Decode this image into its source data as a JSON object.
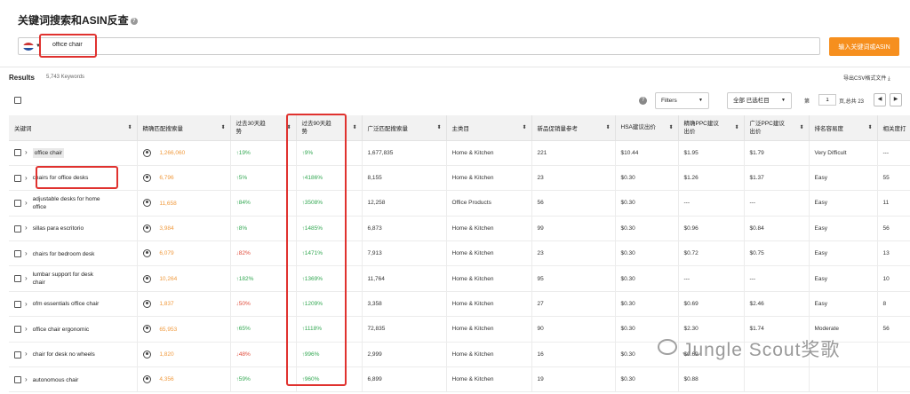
{
  "page": {
    "title": "关键词搜索和ASIN反查",
    "help_icon": "question-icon"
  },
  "search": {
    "value": "office chair",
    "button_label": "输入关键词或ASIN",
    "flag_icon": "us-flag-icon"
  },
  "results": {
    "label": "Results",
    "count": "5,743 Keywords",
    "export_label": "导出CSV格式文件"
  },
  "controls": {
    "filters_label": "Filters",
    "columns_label": "全部 已选栏目",
    "page_prefix": "第",
    "page_number": "1",
    "page_suffix": "页,总共 23"
  },
  "table": {
    "columns": [
      "关键词",
      "精确匹配搜索量",
      "过去30天趋势",
      "过去90天趋势",
      "广泛匹配搜索量",
      "主类目",
      "新品促销量参考",
      "HSA建议出价",
      "精确PPC建议出价",
      "广泛PPC建议出价",
      "排名容易度",
      "相关度打"
    ],
    "rows": [
      {
        "keyword": "office chair",
        "exact": "1,266,060",
        "t30": "19%",
        "t30_dir": "up",
        "t90": "9%",
        "broad": "1,677,835",
        "category": "Home & Kitchen",
        "promo": "221",
        "hsa": "$10.44",
        "exact_ppc": "$1.95",
        "broad_ppc": "$1.79",
        "ease": "Very Difficult",
        "relevance": "---"
      },
      {
        "keyword": "chairs for office desks",
        "exact": "6,796",
        "t30": "5%",
        "t30_dir": "up",
        "t90": "4186%",
        "broad": "8,155",
        "category": "Home & Kitchen",
        "promo": "23",
        "hsa": "$0.30",
        "exact_ppc": "$1.26",
        "broad_ppc": "$1.37",
        "ease": "Easy",
        "relevance": "55"
      },
      {
        "keyword": "adjustable desks for home office",
        "exact": "11,658",
        "t30": "84%",
        "t30_dir": "up",
        "t90": "3508%",
        "broad": "12,258",
        "category": "Office Products",
        "promo": "56",
        "hsa": "$0.30",
        "exact_ppc": "---",
        "broad_ppc": "---",
        "ease": "Easy",
        "relevance": "11"
      },
      {
        "keyword": "sillas para escritorio",
        "exact": "3,984",
        "t30": "8%",
        "t30_dir": "up",
        "t90": "1485%",
        "broad": "6,873",
        "category": "Home & Kitchen",
        "promo": "99",
        "hsa": "$0.30",
        "exact_ppc": "$0.96",
        "broad_ppc": "$0.84",
        "ease": "Easy",
        "relevance": "56"
      },
      {
        "keyword": "chairs for bedroom desk",
        "exact": "6,079",
        "t30": "82%",
        "t30_dir": "down",
        "t90": "1471%",
        "broad": "7,913",
        "category": "Home & Kitchen",
        "promo": "23",
        "hsa": "$0.30",
        "exact_ppc": "$0.72",
        "broad_ppc": "$0.75",
        "ease": "Easy",
        "relevance": "13"
      },
      {
        "keyword": "lumbar support for desk chair",
        "exact": "10,264",
        "t30": "182%",
        "t30_dir": "up",
        "t90": "1369%",
        "broad": "11,764",
        "category": "Home & Kitchen",
        "promo": "95",
        "hsa": "$0.30",
        "exact_ppc": "---",
        "broad_ppc": "---",
        "ease": "Easy",
        "relevance": "10"
      },
      {
        "keyword": "ofm essentials office chair",
        "exact": "1,837",
        "t30": "50%",
        "t30_dir": "down",
        "t90": "1209%",
        "broad": "3,358",
        "category": "Home & Kitchen",
        "promo": "27",
        "hsa": "$0.30",
        "exact_ppc": "$0.69",
        "broad_ppc": "$2.46",
        "ease": "Easy",
        "relevance": "8"
      },
      {
        "keyword": "office chair ergonomic",
        "exact": "65,953",
        "t30": "65%",
        "t30_dir": "up",
        "t90": "1118%",
        "broad": "72,835",
        "category": "Home & Kitchen",
        "promo": "90",
        "hsa": "$0.30",
        "exact_ppc": "$2.30",
        "broad_ppc": "$1.74",
        "ease": "Moderate",
        "relevance": "56"
      },
      {
        "keyword": "chair for desk no wheels",
        "exact": "1,820",
        "t30": "48%",
        "t30_dir": "down",
        "t90": "996%",
        "broad": "2,999",
        "category": "Home & Kitchen",
        "promo": "16",
        "hsa": "$0.30",
        "exact_ppc": "$0.69",
        "broad_ppc": "",
        "ease": "",
        "relevance": ""
      },
      {
        "keyword": "autonomous chair",
        "exact": "4,356",
        "t30": "59%",
        "t30_dir": "up",
        "t90": "960%",
        "broad": "6,899",
        "category": "Home & Kitchen",
        "promo": "19",
        "hsa": "$0.30",
        "exact_ppc": "$0.88",
        "broad_ppc": "",
        "ease": "",
        "relevance": ""
      }
    ]
  },
  "watermark": "Jungle Scout奖歌"
}
